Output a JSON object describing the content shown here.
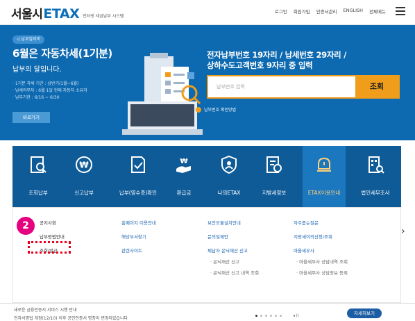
{
  "header": {
    "logo_main": "서울시",
    "logo_etax": "ETAX",
    "logo_sub": "인터넷 세금납부 시스템",
    "links": [
      "로그인",
      "회원가입",
      "인증서관리",
      "ENGLISH",
      "전체메뉴"
    ]
  },
  "hero": {
    "badge": "납부알리미",
    "title": "6월은 자동차세(1기분)",
    "subtitle": "납부의 달입니다.",
    "info": [
      "· 1기분 과세 기간 : 상반기(1월~6월)",
      "· 납세의무자 : 6월 1일 현재 자동차 소유자",
      "· 납부기한 : 6/16 ~ 6/30"
    ],
    "go_button": "바로가기",
    "pay_heading_line1": "전자납부번호 19자리 / 납세번호 29자리 /",
    "pay_heading_line2": "상하수도고객번호 9자리 중 입력",
    "pay_placeholder": "납부번호 입력",
    "pay_button": "조회",
    "helper": "납부번호 확인방법"
  },
  "nav": {
    "items": [
      {
        "label": "조회납부",
        "icon": "search-document-icon"
      },
      {
        "label": "신고납부",
        "icon": "won-coin-icon"
      },
      {
        "label": "납부(영수증)확인",
        "icon": "receipt-check-icon"
      },
      {
        "label": "환급금",
        "icon": "refund-hand-icon"
      },
      {
        "label": "나의ETAX",
        "icon": "user-id-icon"
      },
      {
        "label": "지방세정보",
        "icon": "info-document-icon"
      },
      {
        "label": "ETAX이용안내",
        "icon": "alert-bell-icon"
      },
      {
        "label": "법인세무조사",
        "icon": "building-search-icon"
      }
    ],
    "active_index": 6
  },
  "submenu": {
    "col1": [
      "공지사항",
      "납부방법안내",
      "조회/발급"
    ],
    "col2": [
      "홈페이지 이용안내",
      "해당부서찾기",
      "관련사이트"
    ],
    "col3": [
      "보안모듈설치안내",
      "문의및제안",
      "체납자 은닉재산 신고",
      "· 은닉재산 신고",
      "· 은닉재산 신고 내역 조회"
    ],
    "col4": [
      "자주묻는질문",
      "지방세이의신청/조회",
      "마을세무사",
      "· 마을세무사 상담내역 조회",
      "· 마을세무사 상담정보 등록"
    ],
    "step_badge": "2"
  },
  "footer": {
    "line1": "새로운 금융인증서 서비스 시행 안내",
    "line2": "전자서명법 개정(12/10) 이후 공인인증서 명칭이 변경되었습니다",
    "pager": "◂ II",
    "more_button": "자세히보기"
  },
  "colors": {
    "hero_bg": "#0d69b0",
    "nav_bg": "#0f5b98",
    "accent_orange": "#f09d1c",
    "step_badge": "#e4007f",
    "highlight_red": "#e8001f"
  }
}
